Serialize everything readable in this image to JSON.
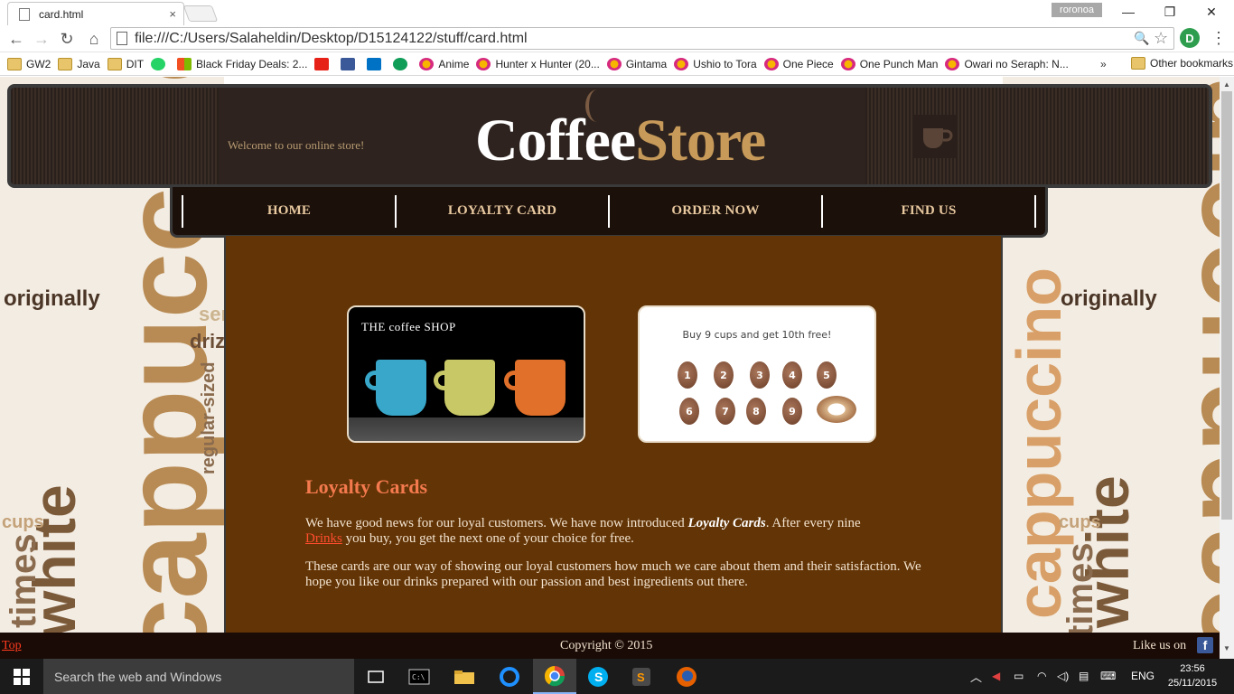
{
  "browser": {
    "tab_title": "card.html",
    "tab_close": "×",
    "user_badge": "roronoa",
    "minimize": "—",
    "restore": "❐",
    "close": "✕",
    "url": "file:///C:/Users/Salaheldin/Desktop/D15124122/stuff/card.html",
    "back": "←",
    "forward": "→",
    "reload": "↻",
    "home": "⌂",
    "zoom_icon": "🔍",
    "star_icon": "☆",
    "extension": "D",
    "menu": "⋮",
    "bookmarks": [
      {
        "label": "GW2",
        "icon": "folder"
      },
      {
        "label": "Java",
        "icon": "folder"
      },
      {
        "label": "DIT",
        "icon": "folder"
      },
      {
        "label": "",
        "icon": "whatsapp"
      },
      {
        "label": "Black Friday Deals: 2...",
        "icon": "windows"
      },
      {
        "label": "",
        "icon": "youtube"
      },
      {
        "label": "",
        "icon": "facebook"
      },
      {
        "label": "",
        "icon": "outlook"
      },
      {
        "label": "",
        "icon": "hangouts"
      },
      {
        "label": "Anime",
        "icon": "crunchy"
      },
      {
        "label": "Hunter x Hunter (20...",
        "icon": "crunchy"
      },
      {
        "label": "Gintama",
        "icon": "crunchy"
      },
      {
        "label": "Ushio to Tora",
        "icon": "crunchy"
      },
      {
        "label": "One Piece",
        "icon": "crunchy"
      },
      {
        "label": "One Punch Man",
        "icon": "crunchy"
      },
      {
        "label": "Owari no Seraph: N...",
        "icon": "crunchy"
      }
    ],
    "bookmarks_more": "»",
    "other_bookmarks": "Other bookmarks"
  },
  "page": {
    "welcome": "Welcome to our online store!",
    "logo_part1": "Coffee",
    "logo_part2": "Store",
    "nav": [
      "HOME",
      "LOYALTY CARD",
      "ORDER NOW",
      "FIND US"
    ],
    "shop_card_title": "THE coffee SHOP",
    "promo_text": "Buy 9 cups and get 10th free!",
    "beans": [
      "1",
      "2",
      "3",
      "4",
      "5",
      "6",
      "7",
      "8",
      "9"
    ],
    "heading": "Loyalty Cards",
    "para1_a": "We have good news for our loyal customers. We have now introduced ",
    "para1_em": "Loyalty Cards",
    "para1_b": ". After every nine ",
    "para1_link": "Drinks",
    "para1_c": " you buy, you get the next one of your choice for free.",
    "para2": "These cards are our way of showing our loyal customers how much we care about them and their satisfaction. We hope you like our drinks prepared with our passion and best ingredients out there.",
    "footer_top": "Top",
    "footer_copy": "Copyright © 2015",
    "footer_like": "Like us on",
    "footer_fb": "f",
    "bg_words": [
      "originally",
      "white",
      "cappuccino",
      "regular-sized",
      "cups",
      "times",
      "ser",
      "driz",
      "dr"
    ]
  },
  "taskbar": {
    "search_placeholder": "Search the web and Windows",
    "lang": "ENG",
    "time": "23:56",
    "date": "25/11/2015"
  },
  "colors": {
    "content_bg": "#623406",
    "heading": "#f47a4e",
    "nav_text": "#e8c9a0",
    "link": "#ff4d2e",
    "logo_accent": "#c79a5a"
  }
}
